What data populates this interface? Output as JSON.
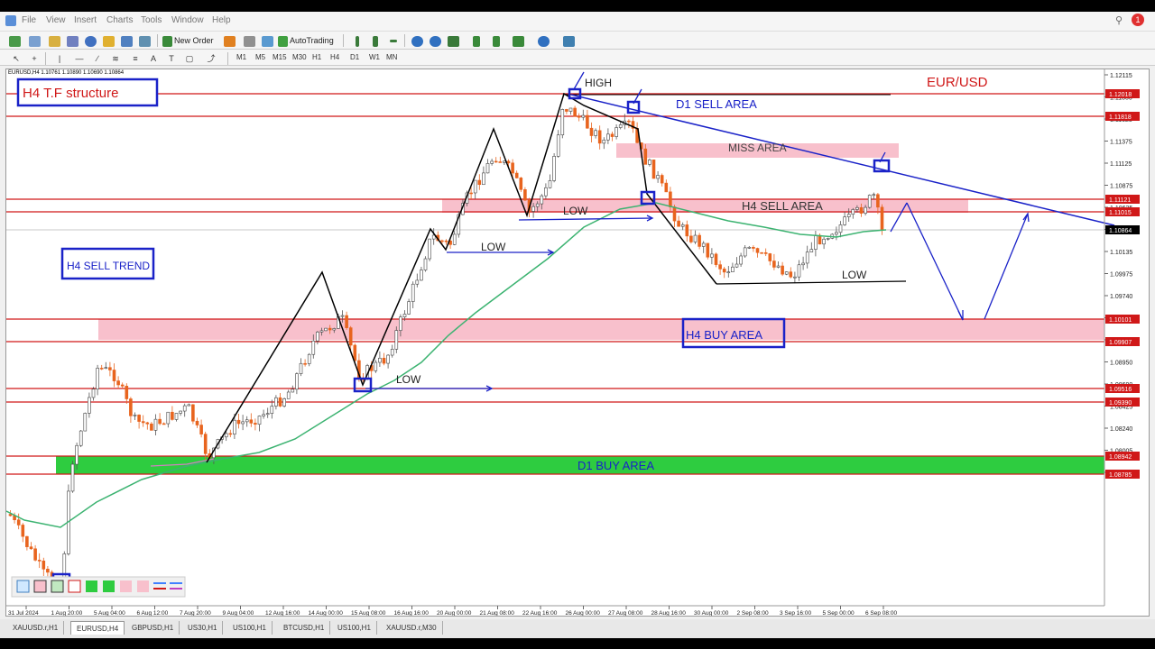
{
  "menu": {
    "items": [
      "File",
      "View",
      "Insert",
      "Charts",
      "Tools",
      "Window",
      "Help"
    ],
    "notifications": "1"
  },
  "toolbar": {
    "new_order": "New Order",
    "autotrading": "AutoTrading",
    "timeframes": [
      "M1",
      "M5",
      "M15",
      "M30",
      "H1",
      "H4",
      "D1",
      "W1",
      "MN"
    ]
  },
  "chart": {
    "info": "EURUSD,H4  1.10761 1.10890 1.10690 1.10864",
    "price_labels": [
      "1.12115",
      "1.11855",
      "1.11625",
      "1.11375",
      "1.11125",
      "1.10875",
      "1.10625",
      "1.10395",
      "1.10135",
      "1.09975",
      "1.09740",
      "1.09410",
      "1.09180",
      "1.08950",
      "1.08690",
      "1.08425",
      "1.08240",
      "1.08005",
      "1.07765"
    ],
    "level_labels": [
      {
        "text": "1.12018",
        "color": "#d01818"
      },
      {
        "text": "1.11818",
        "color": "#d01818"
      },
      {
        "text": "1.11121",
        "color": "#d01818"
      },
      {
        "text": "1.11015",
        "color": "#d01818"
      },
      {
        "text": "1.10864",
        "color": "#000000"
      },
      {
        "text": "1.10101",
        "color": "#d01818"
      },
      {
        "text": "1.09907",
        "color": "#d01818"
      },
      {
        "text": "1.09516",
        "color": "#d01818"
      },
      {
        "text": "1.09390",
        "color": "#d01818"
      },
      {
        "text": "1.08942",
        "color": "#d01818"
      },
      {
        "text": "1.08785",
        "color": "#d01818"
      }
    ],
    "time_labels": [
      "31 Jul 2024",
      "1 Aug 20:00",
      "5 Aug 04:00",
      "6 Aug 12:00",
      "7 Aug 20:00",
      "9 Aug 04:00",
      "12 Aug 16:00",
      "14 Aug 00:00",
      "15 Aug 08:00",
      "16 Aug 16:00",
      "20 Aug 00:00",
      "21 Aug 08:00",
      "22 Aug 16:00",
      "26 Aug 00:00",
      "27 Aug 08:00",
      "28 Aug 16:00",
      "30 Aug 00:00",
      "2 Sep 08:00",
      "3 Sep 16:00",
      "5 Sep 00:00",
      "6 Sep 08:00"
    ],
    "annotations": {
      "title": "H4  T.F  structure",
      "pair": "EUR/USD",
      "h4_sell_trend": "H4 SELL TREND",
      "high": "HIGH",
      "d1_sell_area": "D1 SELL AREA",
      "miss_area": "MISS AREA",
      "h4_sell_area": "H4 SELL AREA",
      "h4_buy_area": "H4 BUY AREA",
      "d1_buy_area": "D1 BUY AREA",
      "low_1": "LOW",
      "low_2": "LOW",
      "low_3": "LOW",
      "low_4": "LOW"
    },
    "colors": {
      "bull": "#ffffff",
      "bear": "#e8641e",
      "ma": "#3cb371",
      "level": "#d01818",
      "zone_pink": "#f8c0cc",
      "zone_green": "#2ecc40",
      "annot_blue": "#1a22c8"
    }
  },
  "tabs": [
    "XAUUSD.r,H1",
    "EURUSD,H4",
    "GBPUSD,H1",
    "US30,H1",
    "US100,H1",
    "BTCUSD,H1",
    "US100,H1",
    "XAUUSD.r,M30"
  ],
  "active_tab": "EURUSD,H4"
}
